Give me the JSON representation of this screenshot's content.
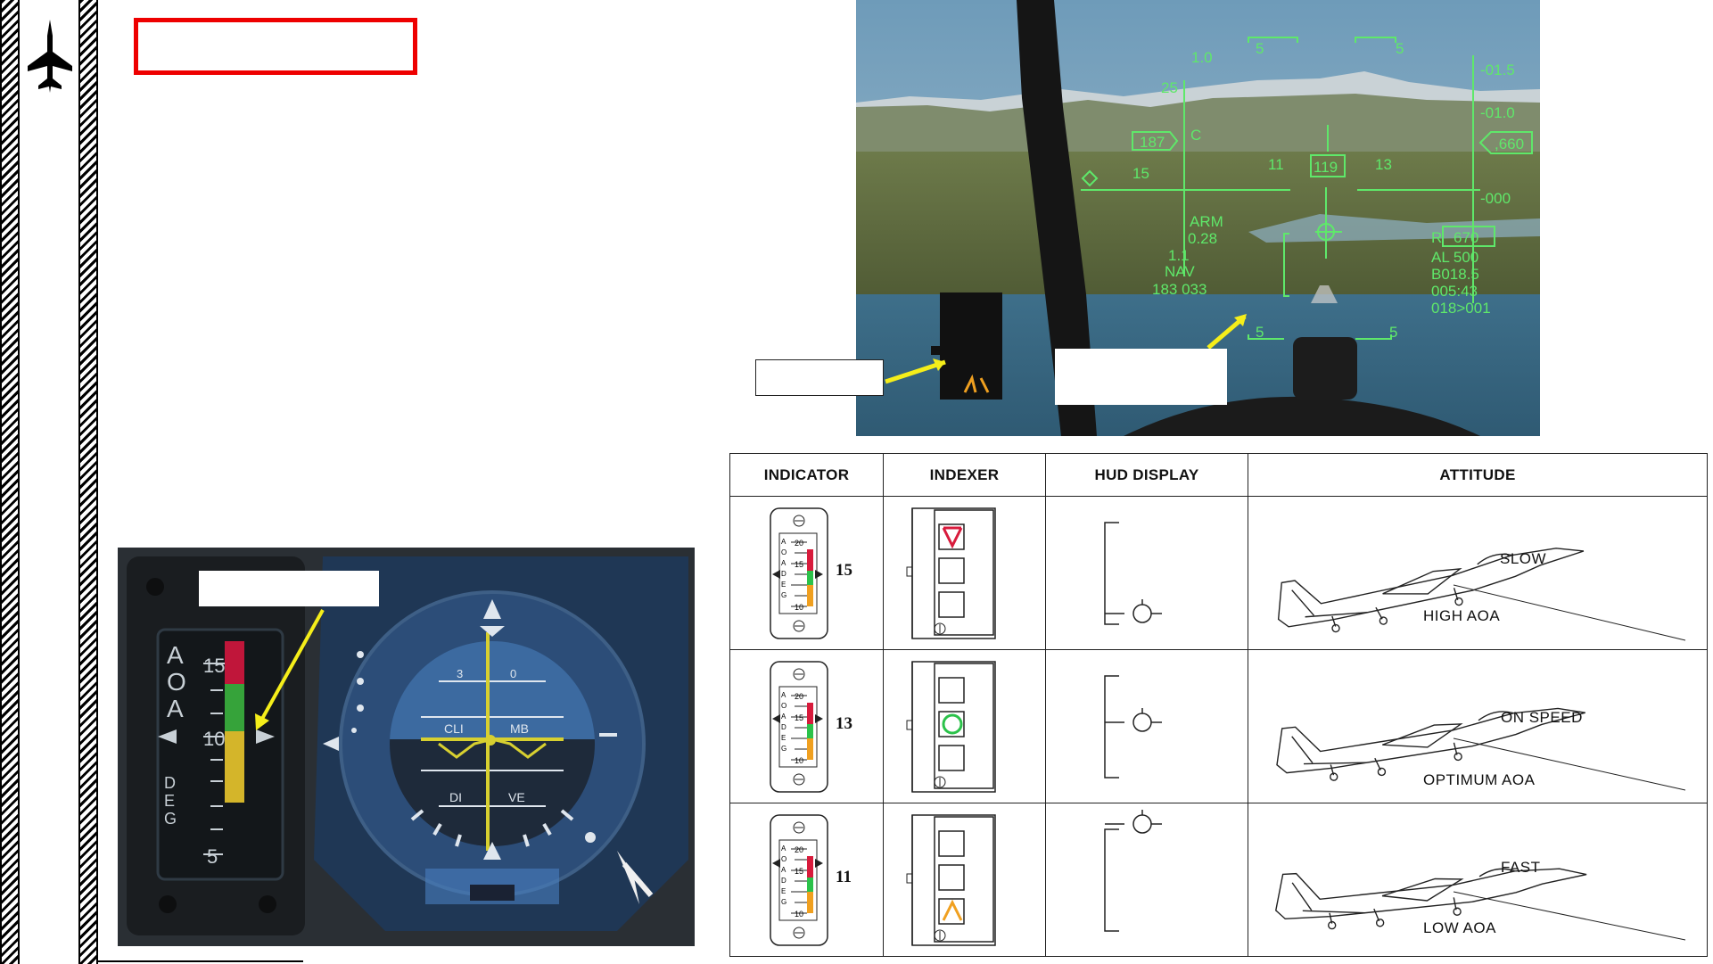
{
  "title_box": {
    "text": ""
  },
  "hud": {
    "pitch_top": "1.0",
    "heading_marks": [
      "5",
      "5"
    ],
    "heading_left": "11",
    "heading_current": "119",
    "heading_right": "13",
    "pitch_25": "25",
    "pitch_15": "15",
    "speed_box": "187",
    "speed_c": "C",
    "alt_box": ",660",
    "scale_r": [
      "-01.5",
      "-01.0",
      "-000"
    ],
    "arm": "ARM",
    "arm_val": "0.28",
    "gs": "1.1",
    "nav": "NAV",
    "nav_val": "183  033",
    "radar_r": "R",
    "radar_val": "670",
    "al": "AL  500",
    "b": "B018.5",
    "t": "005:43",
    "w": "018>001",
    "bottom_marks": [
      "5",
      "5"
    ]
  },
  "callouts": {
    "indexer": "",
    "hud_bracket": "",
    "aoa_gauge": ""
  },
  "gauge": {
    "aoa_letters": [
      "A",
      "O",
      "A"
    ],
    "deg_letters": [
      "D",
      "E",
      "G"
    ],
    "ticks": [
      "15",
      "10",
      "5"
    ],
    "adi_top": [
      "3",
      "0"
    ],
    "adi_climb": "CLI",
    "adi_mb": "MB",
    "adi_dive": "DI",
    "adi_ve": "VE"
  },
  "table": {
    "headers": [
      "INDICATOR",
      "INDEXER",
      "HUD DISPLAY",
      "ATTITUDE"
    ],
    "rows": [
      {
        "indicator_value": "15",
        "indexer_lit": "top",
        "attitude_right": "SLOW",
        "attitude_bottom": "HIGH AOA"
      },
      {
        "indicator_value": "13",
        "indexer_lit": "middle",
        "attitude_right": "ON SPEED",
        "attitude_bottom": "OPTIMUM AOA"
      },
      {
        "indicator_value": "11",
        "indexer_lit": "bottom",
        "attitude_right": "FAST",
        "attitude_bottom": "LOW AOA"
      }
    ],
    "gauge_ticks": [
      "20",
      "15",
      "10"
    ],
    "gauge_letters": [
      "A",
      "O",
      "A",
      "D",
      "E",
      "G"
    ]
  },
  "colors": {
    "hud_green": "#5fe86a",
    "callout_arrow": "#f5ee1a",
    "title_border": "#ee0000",
    "indexer_red": "#d81b3c",
    "indexer_green": "#2bc24a",
    "indexer_amber": "#f0a020"
  }
}
